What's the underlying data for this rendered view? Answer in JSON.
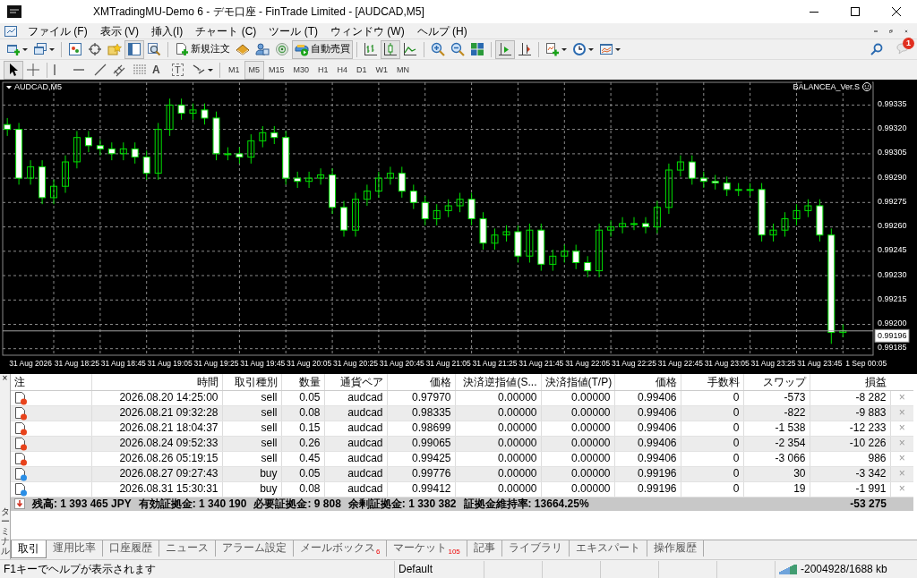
{
  "window": {
    "title": "XMTradingMU-Demo 6 - デモ口座 - FinTrade Limited - [AUDCAD,M5]"
  },
  "menu": [
    "ファイル (F)",
    "表示 (V)",
    "挿入(I)",
    "チャート (C)",
    "ツール (T)",
    "ウィンドウ (W)",
    "ヘルプ (H)"
  ],
  "toolbar_main": [
    {
      "kind": "new-chart",
      "dropdown": true,
      "pressed": false
    },
    {
      "kind": "profiles",
      "dropdown": true,
      "pressed": false
    },
    {
      "kind": "separator"
    },
    {
      "kind": "market-watch",
      "pressed": false
    },
    {
      "kind": "navigator",
      "pressed": false
    },
    {
      "kind": "favorites",
      "pressed": false
    },
    {
      "kind": "terminal",
      "pressed": true
    },
    {
      "kind": "tester",
      "pressed": false
    },
    {
      "kind": "separator"
    },
    {
      "kind": "new-order",
      "label": "新規注文",
      "pressed": false
    },
    {
      "kind": "editor",
      "pressed": false
    },
    {
      "kind": "people",
      "pressed": false
    },
    {
      "kind": "signal",
      "pressed": false
    },
    {
      "kind": "autotrade",
      "label": "自動売買",
      "pressed": true
    },
    {
      "kind": "separator"
    },
    {
      "kind": "bar-chart",
      "pressed": false
    },
    {
      "kind": "candle-chart",
      "pressed": true
    },
    {
      "kind": "line-chart",
      "pressed": false
    },
    {
      "kind": "separator"
    },
    {
      "kind": "zoom-in",
      "pressed": false
    },
    {
      "kind": "zoom-out",
      "pressed": false
    },
    {
      "kind": "tile",
      "pressed": false
    },
    {
      "kind": "separator"
    },
    {
      "kind": "autoscroll",
      "pressed": true
    },
    {
      "kind": "shift",
      "pressed": false
    },
    {
      "kind": "separator"
    },
    {
      "kind": "indicators",
      "dropdown": true,
      "pressed": false
    },
    {
      "kind": "periods",
      "dropdown": true,
      "pressed": false
    },
    {
      "kind": "templates",
      "dropdown": true,
      "pressed": false
    }
  ],
  "notifications": {
    "badge": "1"
  },
  "toolbar_tools": [
    {
      "kind": "cursor",
      "pressed": true
    },
    {
      "kind": "cross",
      "pressed": false
    },
    {
      "kind": "separator"
    },
    {
      "kind": "vline",
      "pressed": false
    },
    {
      "kind": "hline",
      "pressed": false
    },
    {
      "kind": "trend",
      "pressed": false
    },
    {
      "kind": "channel",
      "pressed": false
    },
    {
      "kind": "fibo",
      "pressed": false
    },
    {
      "kind": "text-tool",
      "label": "A",
      "pressed": false
    },
    {
      "kind": "label-tool",
      "label": "T",
      "pressed": false
    },
    {
      "kind": "arrows",
      "dropdown": true,
      "pressed": false
    },
    {
      "kind": "separator"
    }
  ],
  "timeframes": [
    {
      "label": "M1",
      "selected": false
    },
    {
      "label": "M5",
      "selected": true
    },
    {
      "label": "M15",
      "selected": false
    },
    {
      "label": "M30",
      "selected": false
    },
    {
      "label": "H1",
      "selected": false
    },
    {
      "label": "H4",
      "selected": false
    },
    {
      "label": "D1",
      "selected": false
    },
    {
      "label": "W1",
      "selected": false
    },
    {
      "label": "MN",
      "selected": false
    }
  ],
  "chart": {
    "symbol_label": "AUDCAD,M5",
    "indicator_label": "BALANCEA_Ver.S",
    "chart_data": {
      "type": "candlestick",
      "grid": true,
      "categories": [
        null,
        null,
        "31 Aug 2026",
        null,
        null,
        null,
        "31 Aug 18:25",
        null,
        null,
        null,
        "31 Aug 18:45",
        null,
        null,
        null,
        "31 Aug 19:05",
        null,
        null,
        null,
        "31 Aug 19:25",
        null,
        null,
        null,
        "31 Aug 19:45",
        null,
        null,
        null,
        "31 Aug 20:05",
        null,
        null,
        null,
        "31 Aug 20:25",
        null,
        null,
        null,
        "31 Aug 20:45",
        null,
        null,
        null,
        "31 Aug 21:05",
        null,
        null,
        null,
        "31 Aug 21:25",
        null,
        null,
        null,
        "31 Aug 21:45",
        null,
        null,
        null,
        "31 Aug 22:05",
        null,
        null,
        null,
        "31 Aug 22:25",
        null,
        null,
        null,
        "31 Aug 22:45",
        null,
        null,
        null,
        "31 Aug 23:05",
        null,
        null,
        null,
        "31 Aug 23:25",
        null,
        null,
        null,
        "31 Aug 23:45",
        null,
        null,
        null,
        "1 Sep 00:05"
      ],
      "ohlc": [
        [
          0.99323,
          0.99327,
          0.99316,
          0.9932
        ],
        [
          0.9932,
          0.99324,
          0.99286,
          0.9929
        ],
        [
          0.9929,
          0.99301,
          0.99286,
          0.99297
        ],
        [
          0.99297,
          0.99301,
          0.99274,
          0.99278
        ],
        [
          0.99278,
          0.99289,
          0.99274,
          0.99285
        ],
        [
          0.99285,
          0.99304,
          0.99281,
          0.993
        ],
        [
          0.993,
          0.99319,
          0.99296,
          0.99315
        ],
        [
          0.99315,
          0.99319,
          0.99306,
          0.9931
        ],
        [
          0.9931,
          0.99314,
          0.99304,
          0.99308
        ],
        [
          0.99308,
          0.99312,
          0.99301,
          0.99305
        ],
        [
          0.99305,
          0.99312,
          0.99301,
          0.99308
        ],
        [
          0.99308,
          0.99312,
          0.99299,
          0.99303
        ],
        [
          0.99303,
          0.99307,
          0.99289,
          0.99293
        ],
        [
          0.99293,
          0.99324,
          0.99289,
          0.9932
        ],
        [
          0.9932,
          0.99339,
          0.99316,
          0.99335
        ],
        [
          0.99335,
          0.99339,
          0.99326,
          0.9933
        ],
        [
          0.9933,
          0.99336,
          0.99326,
          0.99332
        ],
        [
          0.99332,
          0.99336,
          0.99323,
          0.99327
        ],
        [
          0.99327,
          0.99331,
          0.99301,
          0.99305
        ],
        [
          0.99305,
          0.99309,
          0.99301,
          0.99305
        ],
        [
          0.99305,
          0.99309,
          0.99299,
          0.99303
        ],
        [
          0.99303,
          0.99317,
          0.99299,
          0.99313
        ],
        [
          0.99313,
          0.99322,
          0.99309,
          0.99318
        ],
        [
          0.99318,
          0.99322,
          0.99311,
          0.99315
        ],
        [
          0.99315,
          0.99319,
          0.99286,
          0.9929
        ],
        [
          0.9929,
          0.99294,
          0.99284,
          0.99288
        ],
        [
          0.99288,
          0.99294,
          0.99284,
          0.9929
        ],
        [
          0.9929,
          0.99296,
          0.99286,
          0.99292
        ],
        [
          0.99292,
          0.99296,
          0.99268,
          0.99272
        ],
        [
          0.99272,
          0.99276,
          0.99254,
          0.99258
        ],
        [
          0.99258,
          0.99281,
          0.99254,
          0.99277
        ],
        [
          0.99277,
          0.99286,
          0.99273,
          0.99282
        ],
        [
          0.99282,
          0.99294,
          0.99278,
          0.9929
        ],
        [
          0.9929,
          0.99297,
          0.99286,
          0.99293
        ],
        [
          0.99293,
          0.99297,
          0.99278,
          0.99282
        ],
        [
          0.99282,
          0.99286,
          0.99271,
          0.99275
        ],
        [
          0.99275,
          0.99279,
          0.99261,
          0.99265
        ],
        [
          0.99265,
          0.99274,
          0.99261,
          0.9927
        ],
        [
          0.9927,
          0.99277,
          0.99266,
          0.99273
        ],
        [
          0.99273,
          0.99281,
          0.99269,
          0.99277
        ],
        [
          0.99277,
          0.99281,
          0.99261,
          0.99265
        ],
        [
          0.99265,
          0.99269,
          0.99246,
          0.9925
        ],
        [
          0.9925,
          0.99259,
          0.99246,
          0.99255
        ],
        [
          0.99255,
          0.99261,
          0.99251,
          0.99257
        ],
        [
          0.99257,
          0.99261,
          0.99238,
          0.99242
        ],
        [
          0.99242,
          0.99262,
          0.99238,
          0.99258
        ],
        [
          0.99258,
          0.99262,
          0.99233,
          0.99237
        ],
        [
          0.99237,
          0.99246,
          0.99233,
          0.99242
        ],
        [
          0.99242,
          0.99249,
          0.99238,
          0.99245
        ],
        [
          0.99245,
          0.99249,
          0.99234,
          0.99238
        ],
        [
          0.99238,
          0.99242,
          0.99229,
          0.99233
        ],
        [
          0.99233,
          0.99262,
          0.99229,
          0.99258
        ],
        [
          0.99258,
          0.99264,
          0.99254,
          0.9926
        ],
        [
          0.9926,
          0.99266,
          0.99256,
          0.99262
        ],
        [
          0.99262,
          0.99266,
          0.99258,
          0.99262
        ],
        [
          0.99262,
          0.99266,
          0.99256,
          0.9926
        ],
        [
          0.9926,
          0.99276,
          0.99256,
          0.99272
        ],
        [
          0.99272,
          0.99299,
          0.99268,
          0.99295
        ],
        [
          0.99295,
          0.99304,
          0.99291,
          0.993
        ],
        [
          0.993,
          0.99304,
          0.99286,
          0.9929
        ],
        [
          0.9929,
          0.99294,
          0.99284,
          0.99288
        ],
        [
          0.99288,
          0.99292,
          0.99283,
          0.99287
        ],
        [
          0.99287,
          0.99291,
          0.99279,
          0.99283
        ],
        [
          0.99283,
          0.99287,
          0.99279,
          0.99283
        ],
        [
          0.99283,
          0.99287,
          0.99279,
          0.99283
        ],
        [
          0.99283,
          0.99287,
          0.99251,
          0.99255
        ],
        [
          0.99255,
          0.99262,
          0.99251,
          0.99258
        ],
        [
          0.99258,
          0.99269,
          0.99254,
          0.99265
        ],
        [
          0.99265,
          0.99274,
          0.99261,
          0.9927
        ],
        [
          0.9927,
          0.99277,
          0.99266,
          0.99273
        ],
        [
          0.99273,
          0.99277,
          0.99251,
          0.99255
        ],
        [
          0.99255,
          0.99259,
          0.99188,
          0.99195
        ],
        [
          0.99195,
          0.992,
          0.99192,
          0.99196
        ],
        null,
        null
      ],
      "ylim": [
        0.99181,
        0.99349
      ],
      "yticks": [
        {
          "value": 0.99335,
          "label": "0.99335"
        },
        {
          "value": 0.9932,
          "label": "0.99320"
        },
        {
          "value": 0.99305,
          "label": "0.99305"
        },
        {
          "value": 0.9929,
          "label": "0.99290"
        },
        {
          "value": 0.99275,
          "label": "0.99275"
        },
        {
          "value": 0.9926,
          "label": "0.99260"
        },
        {
          "value": 0.99245,
          "label": "0.99245"
        },
        {
          "value": 0.9923,
          "label": "0.99230"
        },
        {
          "value": 0.99215,
          "label": "0.99215"
        },
        {
          "value": 0.992,
          "label": "0.99200"
        },
        {
          "value": 0.99185,
          "label": "0.99185"
        }
      ],
      "ref_lines": [
        {
          "axis": "y",
          "value": 0.99196,
          "label": "0.99196"
        }
      ]
    }
  },
  "terminal": {
    "close_label": "×",
    "side_label": "ターミナル",
    "columns": [
      "注",
      "時間",
      "取引種別",
      "数量",
      "通貨ペア",
      "価格",
      "決済逆指値(S...",
      "決済指値(T/P)",
      "価格",
      "手数料",
      "スワップ",
      "損益"
    ],
    "rows": [
      {
        "color": "#e8431c",
        "cells": [
          "",
          "2026.08.20 14:25:00",
          "sell",
          "0.05",
          "audcad",
          "0.97970",
          "0.00000",
          "0.00000",
          "0.99406",
          "0",
          "-573",
          "-8 282"
        ],
        "close": "×"
      },
      {
        "color": "#e8431c",
        "cells": [
          "",
          "2026.08.21 09:32:28",
          "sell",
          "0.08",
          "audcad",
          "0.98335",
          "0.00000",
          "0.00000",
          "0.99406",
          "0",
          "-822",
          "-9 883"
        ],
        "close": "×"
      },
      {
        "color": "#e8431c",
        "cells": [
          "",
          "2026.08.21 18:04:37",
          "sell",
          "0.15",
          "audcad",
          "0.98699",
          "0.00000",
          "0.00000",
          "0.99406",
          "0",
          "-1 538",
          "-12 233"
        ],
        "close": "×"
      },
      {
        "color": "#e8431c",
        "cells": [
          "",
          "2026.08.24 09:52:33",
          "sell",
          "0.26",
          "audcad",
          "0.99065",
          "0.00000",
          "0.00000",
          "0.99406",
          "0",
          "-2 354",
          "-10 226"
        ],
        "close": "×"
      },
      {
        "color": "#e8431c",
        "cells": [
          "",
          "2026.08.26 05:19:15",
          "sell",
          "0.45",
          "audcad",
          "0.99425",
          "0.00000",
          "0.00000",
          "0.99406",
          "0",
          "-3 066",
          "986"
        ],
        "close": "×"
      },
      {
        "color": "#2a8ee6",
        "cells": [
          "",
          "2026.08.27 09:27:43",
          "buy",
          "0.05",
          "audcad",
          "0.99776",
          "0.00000",
          "0.00000",
          "0.99196",
          "0",
          "30",
          "-3 342"
        ],
        "close": "×"
      },
      {
        "color": "#2a8ee6",
        "cells": [
          "",
          "2026.08.31 15:30:31",
          "buy",
          "0.08",
          "audcad",
          "0.99412",
          "0.00000",
          "0.00000",
          "0.99196",
          "0",
          "19",
          "-1 991"
        ],
        "close": "×"
      }
    ],
    "summary": {
      "items": [
        "残高: 1 393 465 JPY",
        "有効証拠金: 1 340 190",
        "必要証拠金: 9 808",
        "余剰証拠金: 1 330 382",
        "証拠金維持率: 13664.25%"
      ],
      "total": "-53 275"
    },
    "tabs": [
      {
        "label": "取引",
        "selected": true
      },
      {
        "label": "運用比率",
        "selected": false
      },
      {
        "label": "口座履歴",
        "selected": false
      },
      {
        "label": "ニュース",
        "selected": false
      },
      {
        "label": "アラーム設定",
        "selected": false
      },
      {
        "label": "メールボックス",
        "badge": "6",
        "selected": false
      },
      {
        "label": "マーケット",
        "badge": "105",
        "selected": false
      },
      {
        "label": "記事",
        "selected": false
      },
      {
        "label": "ライブラリ",
        "selected": false
      },
      {
        "label": "エキスパート",
        "selected": false
      },
      {
        "label": "操作履歴",
        "selected": false
      }
    ]
  },
  "status_bar": {
    "help": "F1キーでヘルプが表示されます",
    "profile": "Default",
    "traffic": "-2004928/1688 kb"
  }
}
